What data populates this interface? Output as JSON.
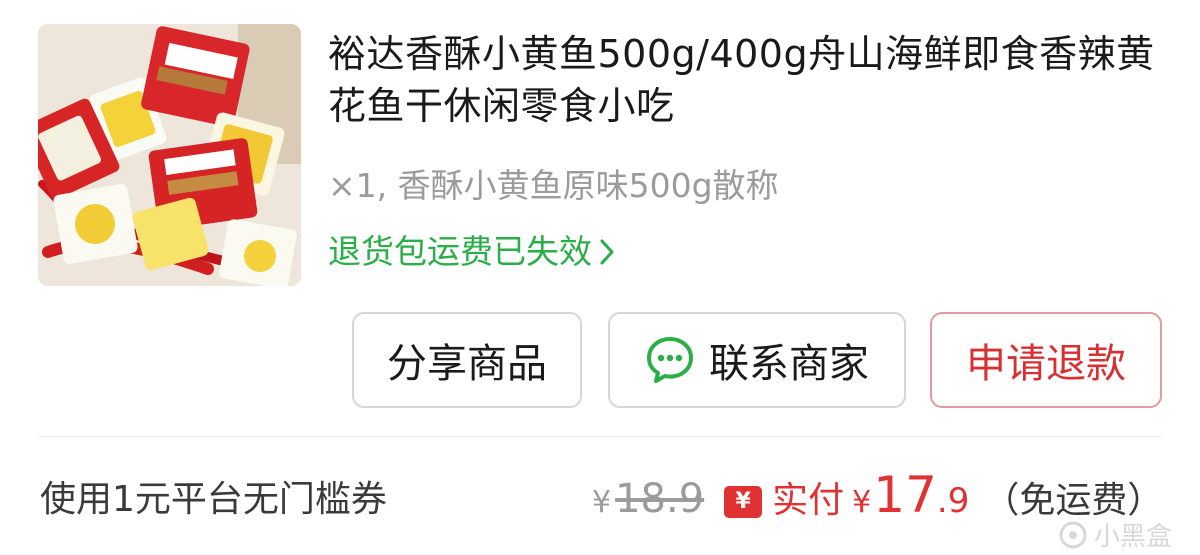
{
  "product": {
    "title": "裕达香酥小黄鱼500g/400g舟山海鲜即食香辣黄花鱼干休闲零食小吃",
    "variant": "×1, 香酥小黄鱼原味500g散称",
    "shipping_notice": "退货包运费已失效"
  },
  "actions": {
    "share_label": "分享商品",
    "contact_label": "联系商家",
    "refund_label": "申请退款"
  },
  "price": {
    "coupon_text": "使用1元平台无门槛券",
    "currency": "¥",
    "original": "18.9",
    "badge": "¥",
    "paid_label": "实付",
    "paid_integer": "17",
    "paid_decimal": ".9",
    "shipping_note": "（免运费）"
  },
  "watermark": {
    "text": "小黑盒"
  },
  "colors": {
    "accent_green": "#2aae47",
    "accent_red": "#e03232",
    "chat_green": "#2aae47"
  }
}
